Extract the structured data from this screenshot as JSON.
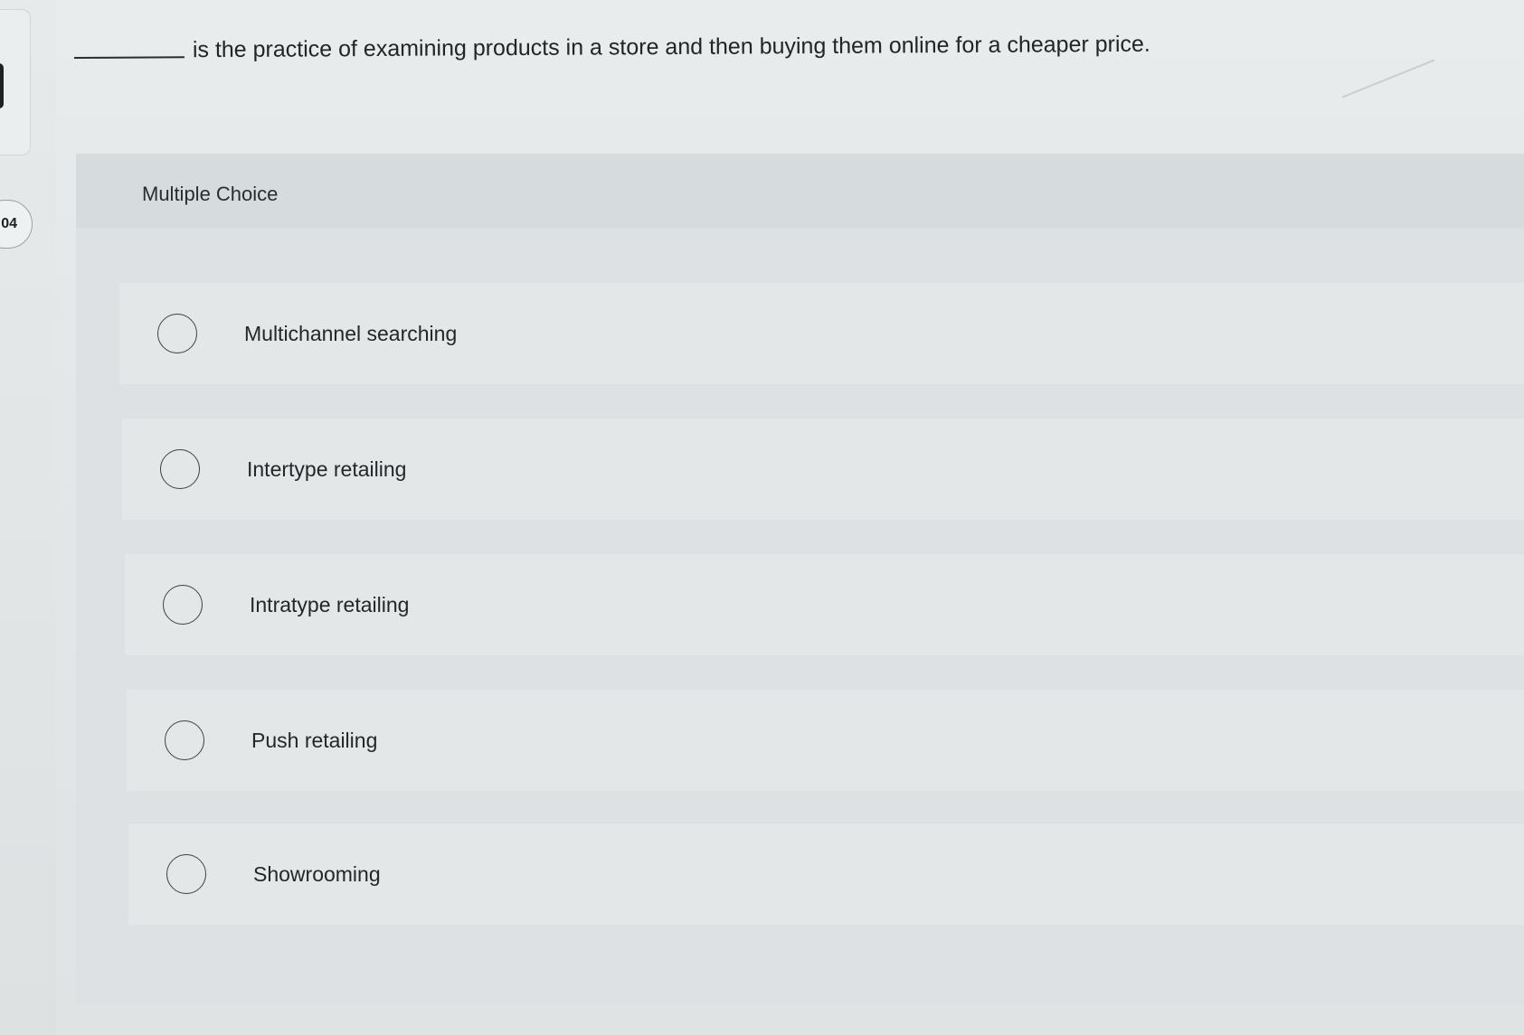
{
  "sidebar": {
    "timer_text": ":04"
  },
  "question": {
    "text": "is the practice of examining products in a store and then buying them online for a cheaper price."
  },
  "panel": {
    "section_label": "Multiple Choice",
    "options": [
      {
        "label": "Multichannel searching",
        "selected": false
      },
      {
        "label": "Intertype retailing",
        "selected": false
      },
      {
        "label": "Intratype retailing",
        "selected": false
      },
      {
        "label": "Push retailing",
        "selected": false
      },
      {
        "label": "Showrooming",
        "selected": false
      }
    ]
  },
  "colors": {
    "page_background": "#e6eaea",
    "panel_background": "#dde1e3",
    "option_background": "#e3e7e8",
    "text": "#24272a",
    "radio_outline": "#3d4245"
  },
  "icons": {
    "radio": "radio-unselected-icon"
  }
}
